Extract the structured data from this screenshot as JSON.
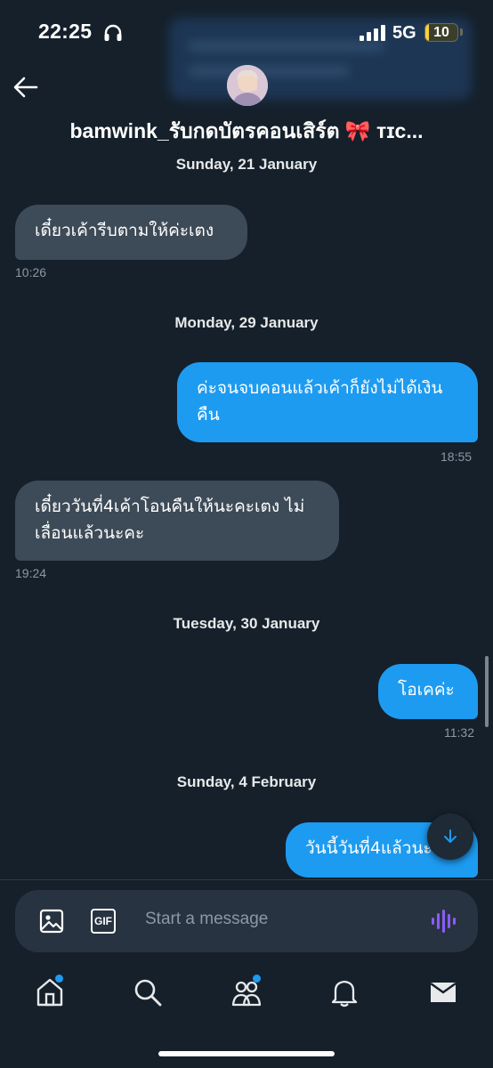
{
  "status_bar": {
    "time": "22:25",
    "network": "5G",
    "battery": "10",
    "battery_level_percent": 10
  },
  "header": {
    "title": "bamwink_รับกดบัตรคอนเสิร์ต 🎀 ᴛɪᴄ..."
  },
  "messages": {
    "date_1": "Sunday, 21 January",
    "msg_1": {
      "text_line1": "เดี๋ยวเค้ารีบตามให้ค่ะเตง",
      "time": "10:26"
    },
    "date_2": "Monday, 29 January",
    "msg_2": {
      "text_line1": "ค่ะจนจบคอนแล้วเค้าก็ยังไม่ได้เงิน",
      "text_line2": "คืน",
      "time": "18:55"
    },
    "msg_3": {
      "text_line1": "เดี๋ยววันที่4เค้าโอนคืนให้นะคะเตง ไม่",
      "text_line2": "เลื่อนแล้วนะคะ",
      "time": "19:24"
    },
    "date_3": "Tuesday, 30 January",
    "msg_4": {
      "text_line1": "โอเคค่ะ",
      "time": "11:32"
    },
    "date_4": "Sunday, 4 February",
    "msg_5": {
      "text_line1": "วันนี้วันที่4แล้วนะ"
    }
  },
  "composer": {
    "placeholder": "Start a message",
    "gif_label": "GIF"
  },
  "colors": {
    "background": "#15202b",
    "accent": "#1d9bf0",
    "incoming_bubble": "#3d4a57",
    "muted_text": "#8b98a5",
    "voice_icon": "#8b5cf6"
  },
  "icons": [
    "headphone-icon",
    "signal-icon",
    "back-icon",
    "image-icon",
    "gif-icon",
    "voice-icon",
    "chevron-down-icon",
    "home-icon",
    "search-icon",
    "communities-icon",
    "notifications-icon",
    "messages-icon"
  ]
}
